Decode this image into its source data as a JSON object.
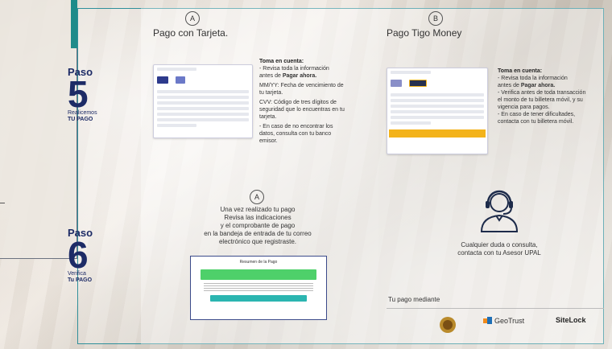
{
  "steps": [
    {
      "paso": "Paso",
      "num": "5",
      "line1": "Realicemos",
      "line2": "TU PAGO"
    },
    {
      "paso": "Paso",
      "num": "6",
      "line1": "Verifica",
      "line2": "Tu PAGO"
    }
  ],
  "col_a": {
    "letter": "A",
    "title": "Pago con Tarjeta.",
    "notes_head": "Toma en cuenta:",
    "notes": [
      "- Revisa toda la información",
      "  antes de ",
      "MM/YY: Fecha de vencimiento de",
      "tu tarjeta.",
      "CVV: Código de tres dígitos de",
      "seguridad  que lo encuentras en tu",
      "tarjeta.",
      "- En caso de no encontrar los",
      "datos, consulta con tu banco",
      "emisor."
    ],
    "bold_word": "Pagar ahora.",
    "mock_brand": "VISA"
  },
  "col_a_lower": {
    "letter": "A",
    "lines": [
      "Una vez realizado tu pago",
      "Revisa  las indicaciones",
      "y el comprobante de pago",
      "en la bandeja de entrada de tu correo",
      "electrónico que registraste."
    ],
    "box_header": "Resumen de la Pago"
  },
  "col_b": {
    "letter": "B",
    "title": "Pago Tigo Money",
    "notes_head": "Toma en cuenta:",
    "notes": [
      "- Revisa toda la información",
      "  antes de ",
      "- Verifica antes de toda transacción",
      "  el monto de tu billetera móvil, y su",
      "  vigencia para pagos.",
      "- En caso de tener dificultades,",
      "  contacta con tu billetera móvil."
    ],
    "bold_word": "Pagar ahora."
  },
  "support": {
    "line1": "Cualquier duda o consulta,",
    "line2": "contacta con tu Asesor UPAL",
    "icon": "headset-agent-icon"
  },
  "footer": {
    "label": "Tu pago mediante",
    "logo1": "seal-icon",
    "logo2": "GeoTrust",
    "logo3": "SiteLock"
  },
  "colors": {
    "accent": "#2f8f9a",
    "navy": "#1d2b66",
    "green": "#4ed06a",
    "yellow": "#f3b31b"
  }
}
